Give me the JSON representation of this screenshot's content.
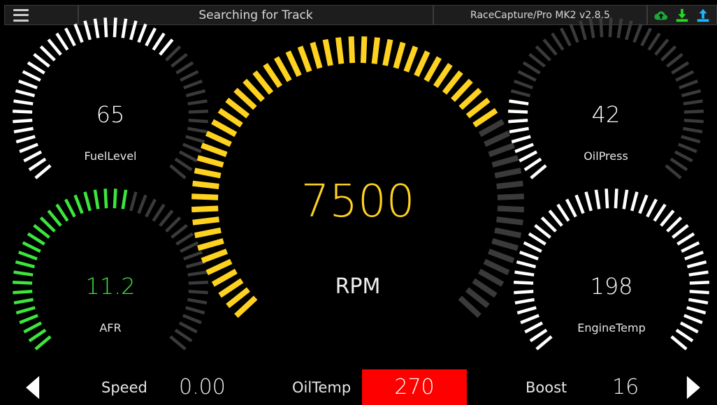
{
  "topbar": {
    "status": "Searching for Track",
    "version": "RaceCapture/Pro MK2 v2.8.5",
    "icons": [
      "menu-icon",
      "cloud-upload-icon",
      "download-icon",
      "upload-icon"
    ],
    "icon_colors": {
      "cloud": "#1fa53a",
      "download": "#22dd22",
      "upload": "#1fb7ff"
    }
  },
  "gauges": {
    "fuel": {
      "label": "FuelLevel",
      "value": "65",
      "level": 0.65,
      "color": "#ffffff"
    },
    "afr": {
      "label": "AFR",
      "value": "11.2",
      "level": 0.55,
      "color": "#3ce63c"
    },
    "rpm": {
      "label": "RPM",
      "value": "7500",
      "level": 0.71,
      "color": "#ffd21f"
    },
    "oilpress": {
      "label": "OilPress",
      "value": "42",
      "level": 0.2,
      "color": "#ffffff"
    },
    "enginetemp": {
      "label": "EngineTemp",
      "value": "198",
      "level": 1.0,
      "color": "#ffffff"
    }
  },
  "bottom": {
    "speed": {
      "label": "Speed",
      "value": "0.00"
    },
    "oiltemp": {
      "label": "OilTemp",
      "value": "270",
      "alert_color": "#ff0000"
    },
    "boost": {
      "label": "Boost",
      "value": "16"
    }
  }
}
